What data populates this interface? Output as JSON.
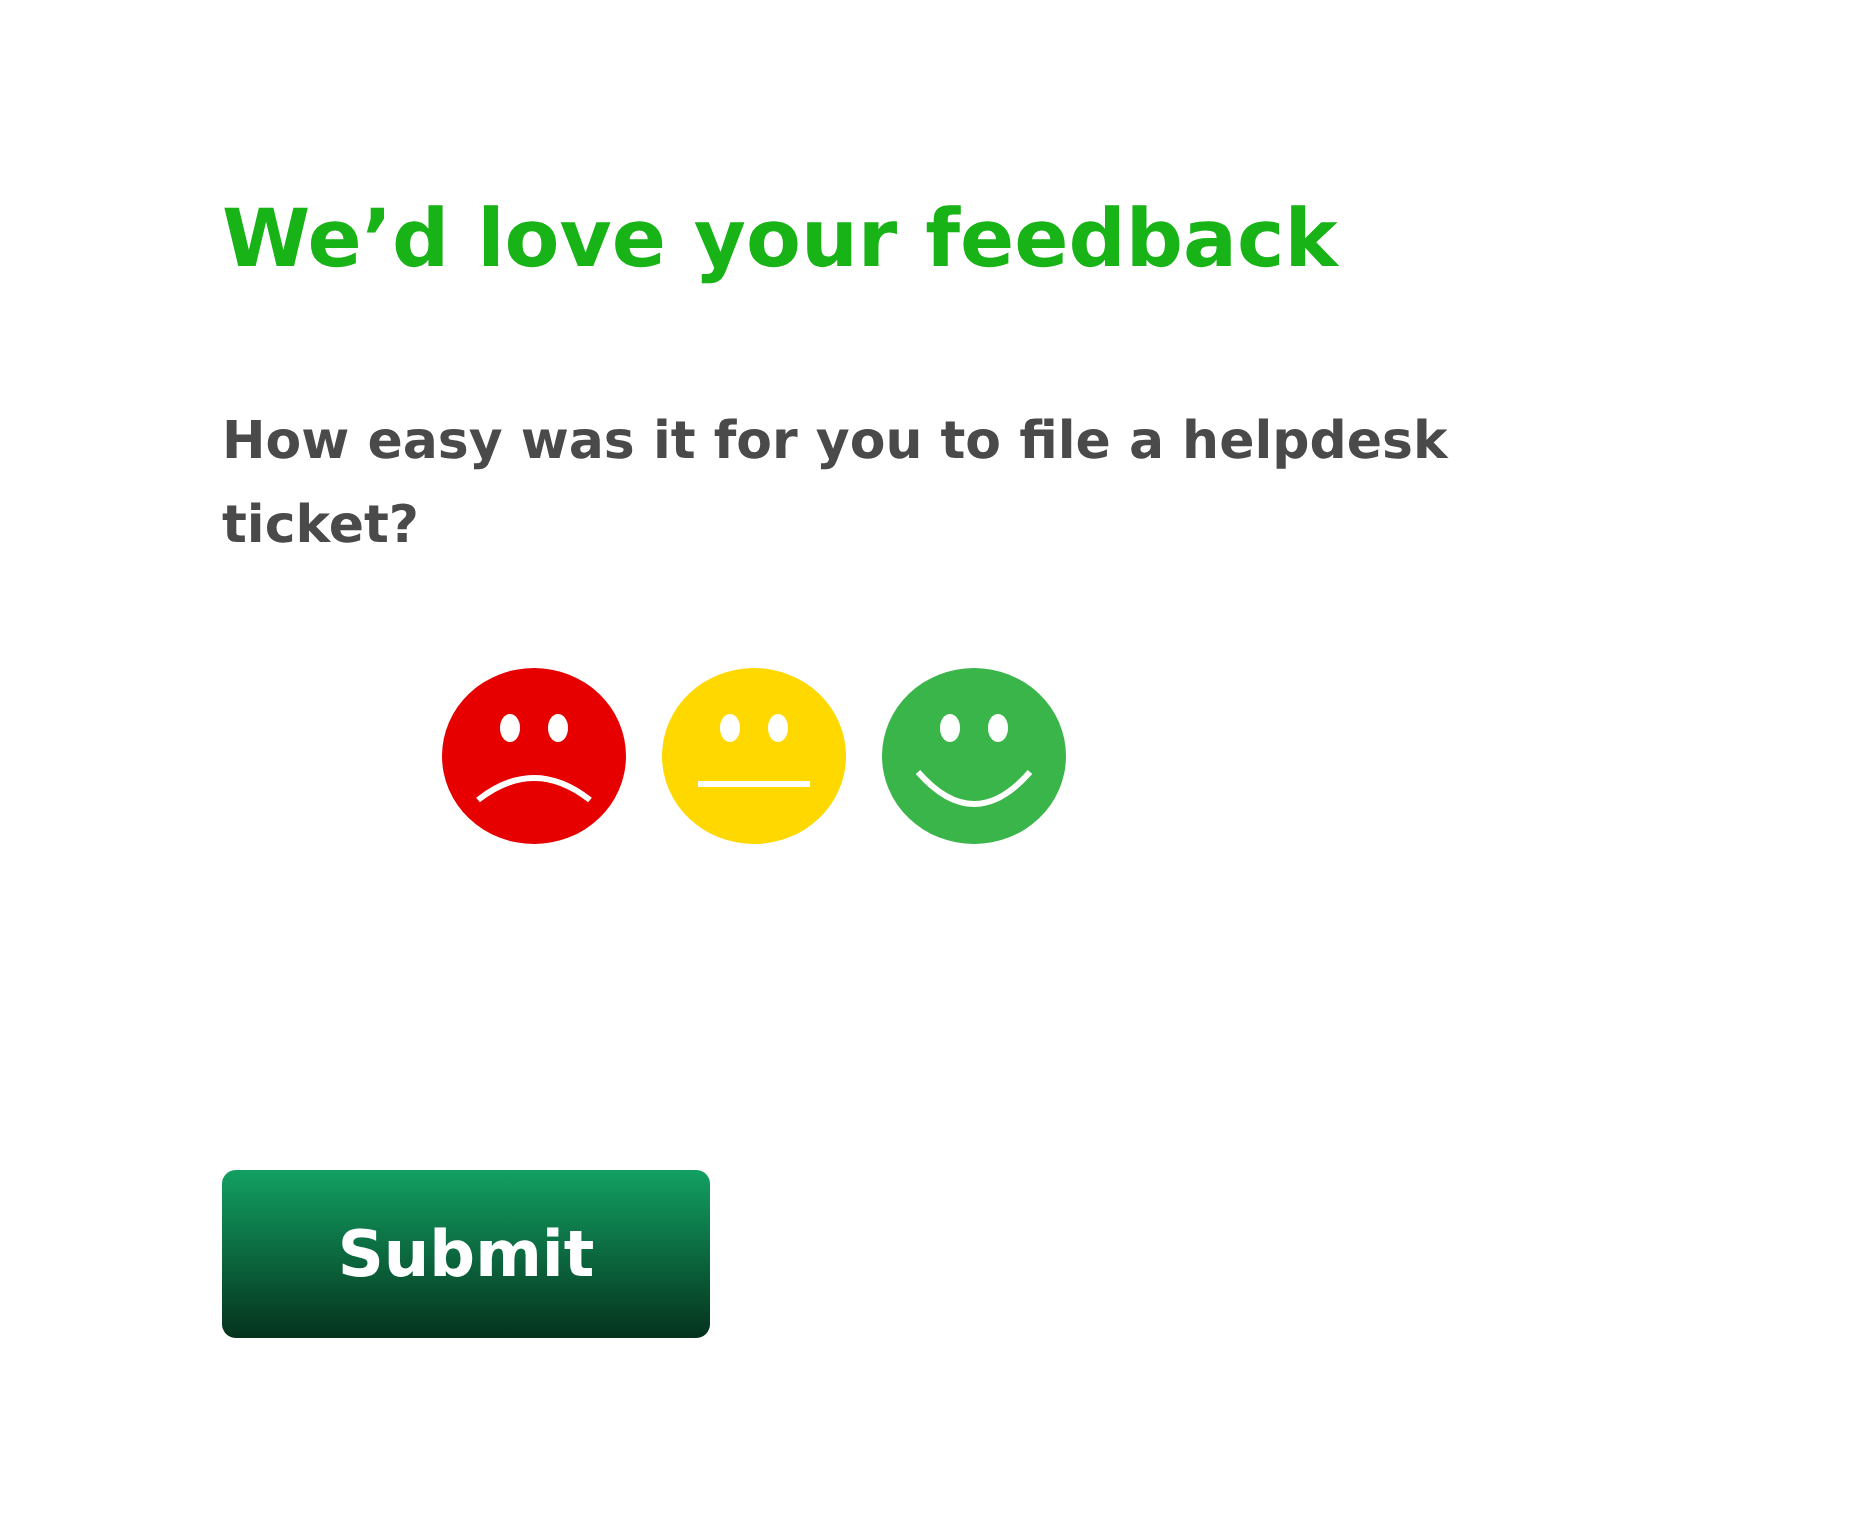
{
  "title": "We’d love your feedback",
  "question": "How easy was it for you to file a helpdesk ticket?",
  "ratings": [
    {
      "kind": "sad",
      "color": "#e60000"
    },
    {
      "kind": "neutral",
      "color": "#ffd800"
    },
    {
      "kind": "happy",
      "color": "#3ab54a"
    }
  ],
  "submit": "Submit"
}
